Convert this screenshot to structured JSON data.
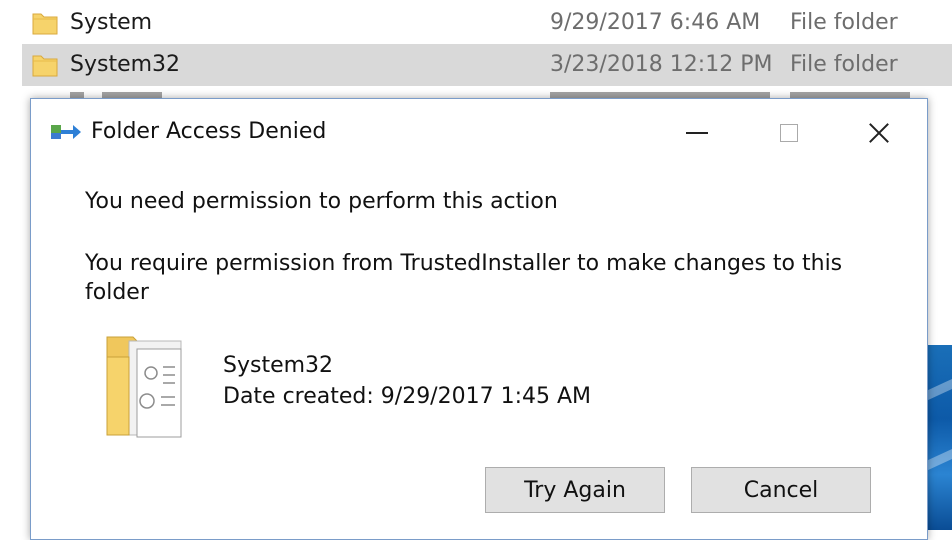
{
  "explorer": {
    "rows": [
      {
        "name": "System",
        "date": "9/29/2017 6:46 AM",
        "type": "File folder",
        "selected": false
      },
      {
        "name": "System32",
        "date": "3/23/2018 12:12 PM",
        "type": "File folder",
        "selected": true
      }
    ]
  },
  "dialog": {
    "title": "Folder Access Denied",
    "heading": "You need permission to perform this action",
    "body": "You require permission from TrustedInstaller to make changes to this folder",
    "item_name": "System32",
    "item_date": "Date created: 9/29/2017 1:45 AM",
    "try_again_label": "Try Again",
    "cancel_label": "Cancel"
  },
  "colors": {
    "selection": "#d9d9d9",
    "folder_yellow": "#f6d36b",
    "dialog_border": "#7a9cc9",
    "button_face": "#e1e1e1"
  },
  "icons": {
    "folder": "folder-icon",
    "app": "move-arrow-icon",
    "minimize": "minimize-icon",
    "maximize": "maximize-icon",
    "close": "close-icon"
  }
}
